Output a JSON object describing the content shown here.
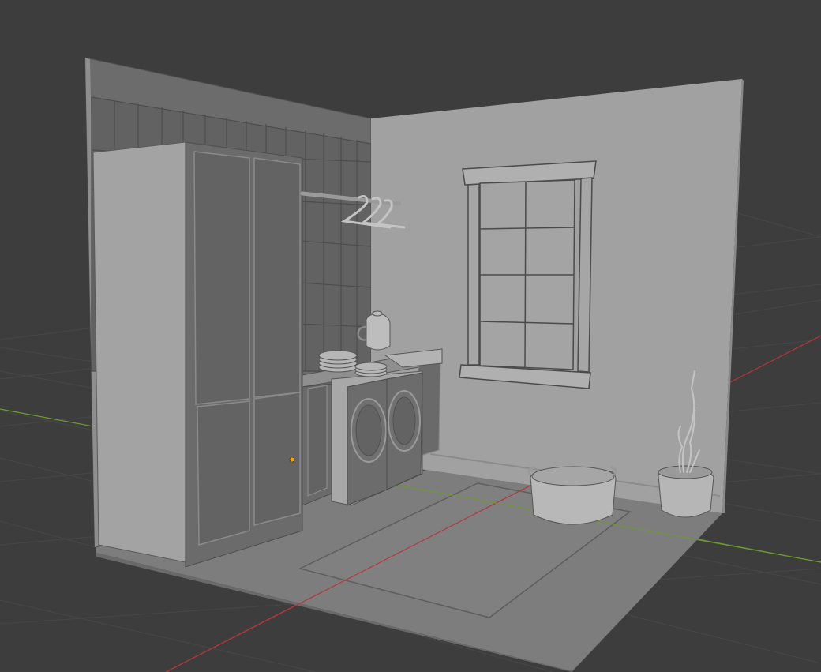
{
  "viewport": {
    "background_color": "#3d3d3d",
    "grid_color": "#474747",
    "x_axis_color": "#b5363f",
    "y_axis_color": "#6e9a2e",
    "origin_marker_color": "#ffa500",
    "shading": "solid",
    "scene_objects": [
      "back-wall",
      "right-wall",
      "floor",
      "rug",
      "tall-cabinet",
      "wall-tiles",
      "hanging-rail",
      "clothes-hangers",
      "water-jug",
      "stacked-plates",
      "counter",
      "washing-machine",
      "dryer",
      "window",
      "laundry-basket",
      "plant-pot"
    ]
  }
}
